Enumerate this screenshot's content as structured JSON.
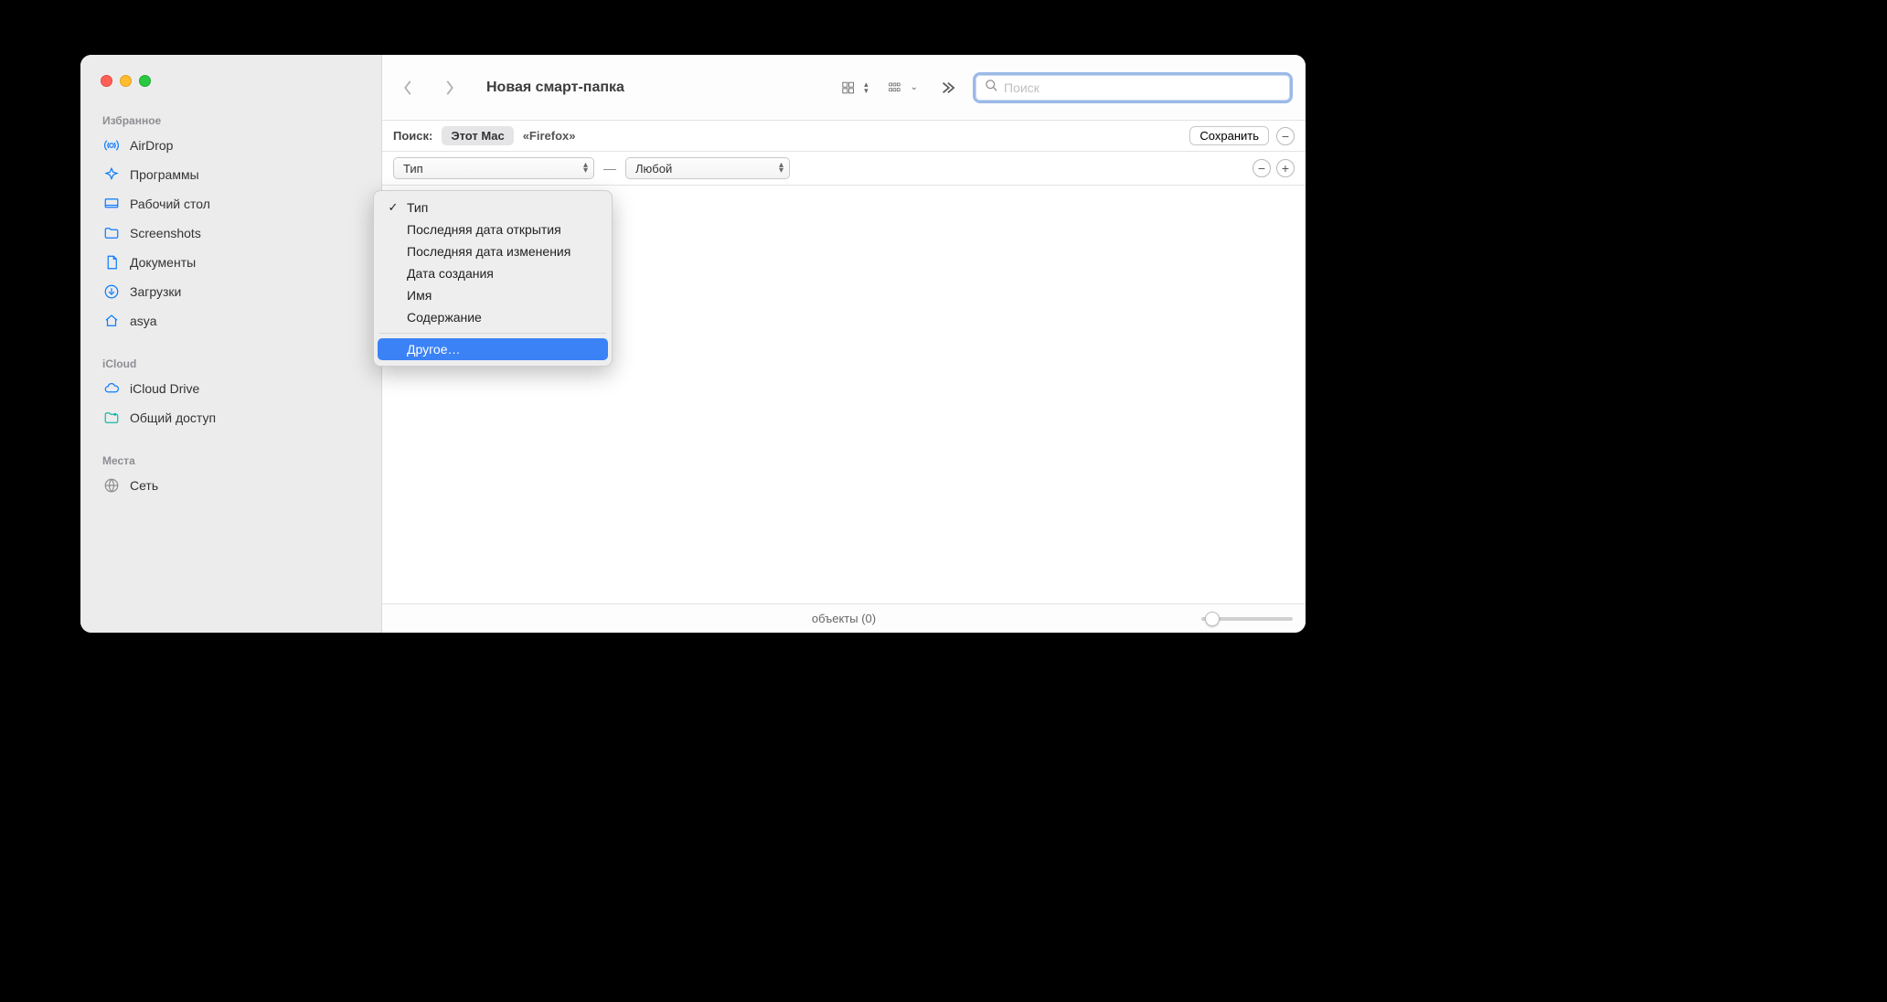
{
  "window": {
    "title": "Новая смарт-папка"
  },
  "search": {
    "placeholder": "Поиск",
    "value": ""
  },
  "sidebar": {
    "sections": [
      {
        "label": "Избранное",
        "items": [
          {
            "icon": "airdrop",
            "label": "AirDrop"
          },
          {
            "icon": "apps",
            "label": "Программы"
          },
          {
            "icon": "desktop",
            "label": "Рабочий стол"
          },
          {
            "icon": "folder",
            "label": "Screenshots"
          },
          {
            "icon": "document",
            "label": "Документы"
          },
          {
            "icon": "downloads",
            "label": "Загрузки"
          },
          {
            "icon": "home",
            "label": "asya"
          }
        ]
      },
      {
        "label": "iCloud",
        "items": [
          {
            "icon": "cloud",
            "label": "iCloud Drive"
          },
          {
            "icon": "shared",
            "label": "Общий доступ"
          }
        ]
      },
      {
        "label": "Места",
        "items": [
          {
            "icon": "network",
            "label": "Сеть"
          }
        ]
      }
    ]
  },
  "scope": {
    "label": "Поиск:",
    "active": "Этот Mac",
    "alt": "«Firefox»",
    "save": "Сохранить"
  },
  "criteria": {
    "attr": "Тип",
    "value": "Любой"
  },
  "dropdown": {
    "checked": "Тип",
    "items": [
      "Последняя дата открытия",
      "Последняя дата изменения",
      "Дата создания",
      "Имя",
      "Содержание"
    ],
    "other": "Другое…"
  },
  "status": {
    "text": "объекты (0)"
  }
}
